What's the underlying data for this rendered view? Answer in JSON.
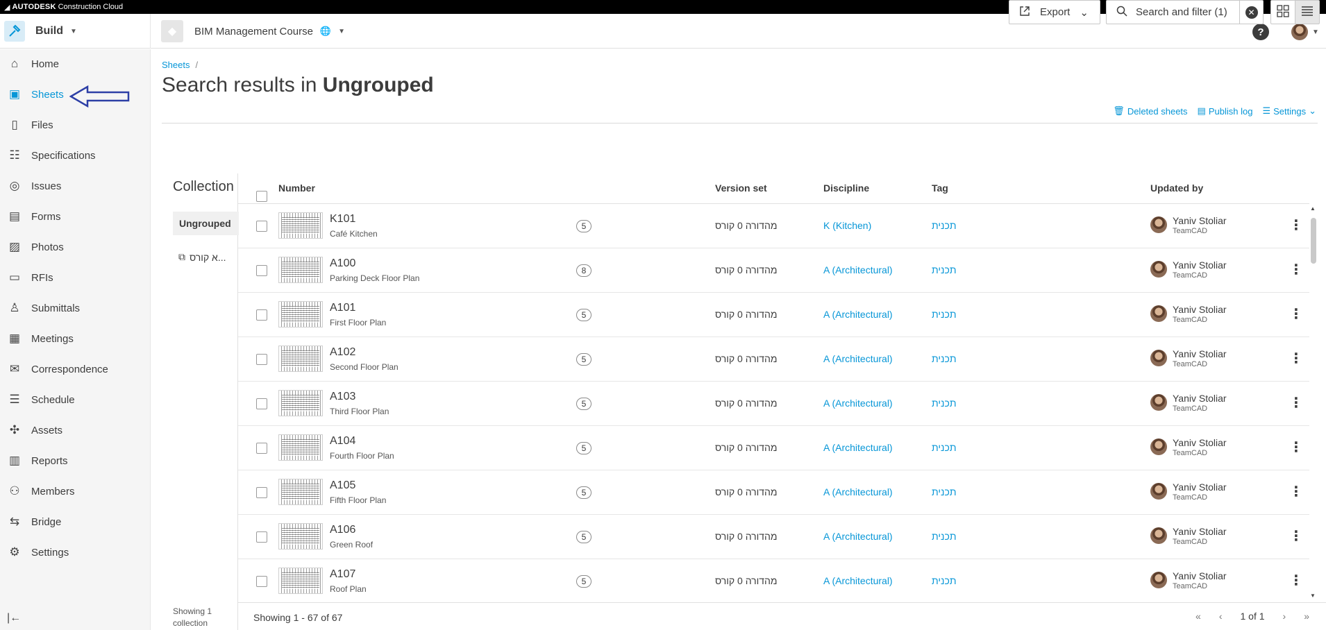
{
  "topbar": {
    "brand": "AUTODESK",
    "product": "Construction Cloud"
  },
  "header": {
    "app_name": "Build",
    "project_name": "BIM Management Course",
    "help_label": "?"
  },
  "sidebar": {
    "items": [
      {
        "label": "Home",
        "icon": "home-icon"
      },
      {
        "label": "Sheets",
        "icon": "sheets-icon"
      },
      {
        "label": "Files",
        "icon": "files-icon"
      },
      {
        "label": "Specifications",
        "icon": "specifications-icon"
      },
      {
        "label": "Issues",
        "icon": "issues-icon"
      },
      {
        "label": "Forms",
        "icon": "forms-icon"
      },
      {
        "label": "Photos",
        "icon": "photos-icon"
      },
      {
        "label": "RFIs",
        "icon": "rfis-icon"
      },
      {
        "label": "Submittals",
        "icon": "submittals-icon"
      },
      {
        "label": "Meetings",
        "icon": "meetings-icon"
      },
      {
        "label": "Correspondence",
        "icon": "correspondence-icon"
      },
      {
        "label": "Schedule",
        "icon": "schedule-icon"
      },
      {
        "label": "Assets",
        "icon": "assets-icon"
      },
      {
        "label": "Reports",
        "icon": "reports-icon"
      },
      {
        "label": "Members",
        "icon": "members-icon"
      },
      {
        "label": "Bridge",
        "icon": "bridge-icon"
      },
      {
        "label": "Settings",
        "icon": "settings-icon"
      }
    ],
    "active": "Sheets"
  },
  "breadcrumb": {
    "root": "Sheets",
    "separator": "/"
  },
  "page": {
    "title_prefix": "Search results in",
    "title_bold": "Ungrouped"
  },
  "links": {
    "deleted": "Deleted sheets",
    "publish": "Publish log",
    "settings": "Settings"
  },
  "toolbar": {
    "export": "Export",
    "search": "Search and filter (1)"
  },
  "collections": {
    "title": "Collection",
    "selected": "Ungrouped",
    "other": "א קורס...",
    "footer_line1": "Showing 1",
    "footer_line2": "collection"
  },
  "table": {
    "columns": {
      "number": "Number",
      "version_set": "Version set",
      "discipline": "Discipline",
      "tag": "Tag",
      "updated_by": "Updated by"
    },
    "rows": [
      {
        "number": "K101",
        "title": "Café Kitchen",
        "versions": "5",
        "version_set": "מהדורה 0 קורס",
        "discipline": "K (Kitchen)",
        "tag": "תכנית",
        "user": "Yaniv Stoliar",
        "company": "TeamCAD"
      },
      {
        "number": "A100",
        "title": "Parking Deck Floor Plan",
        "versions": "8",
        "version_set": "מהדורה 0 קורס",
        "discipline": "A (Architectural)",
        "tag": "תכנית",
        "user": "Yaniv Stoliar",
        "company": "TeamCAD"
      },
      {
        "number": "A101",
        "title": "First Floor Plan",
        "versions": "5",
        "version_set": "מהדורה 0 קורס",
        "discipline": "A (Architectural)",
        "tag": "תכנית",
        "user": "Yaniv Stoliar",
        "company": "TeamCAD"
      },
      {
        "number": "A102",
        "title": "Second Floor Plan",
        "versions": "5",
        "version_set": "מהדורה 0 קורס",
        "discipline": "A (Architectural)",
        "tag": "תכנית",
        "user": "Yaniv Stoliar",
        "company": "TeamCAD"
      },
      {
        "number": "A103",
        "title": "Third Floor Plan",
        "versions": "5",
        "version_set": "מהדורה 0 קורס",
        "discipline": "A (Architectural)",
        "tag": "תכנית",
        "user": "Yaniv Stoliar",
        "company": "TeamCAD"
      },
      {
        "number": "A104",
        "title": "Fourth Floor Plan",
        "versions": "5",
        "version_set": "מהדורה 0 קורס",
        "discipline": "A (Architectural)",
        "tag": "תכנית",
        "user": "Yaniv Stoliar",
        "company": "TeamCAD"
      },
      {
        "number": "A105",
        "title": "Fifth Floor Plan",
        "versions": "5",
        "version_set": "מהדורה 0 קורס",
        "discipline": "A (Architectural)",
        "tag": "תכנית",
        "user": "Yaniv Stoliar",
        "company": "TeamCAD"
      },
      {
        "number": "A106",
        "title": "Green Roof",
        "versions": "5",
        "version_set": "מהדורה 0 קורס",
        "discipline": "A (Architectural)",
        "tag": "תכנית",
        "user": "Yaniv Stoliar",
        "company": "TeamCAD"
      },
      {
        "number": "A107",
        "title": "Roof Plan",
        "versions": "5",
        "version_set": "מהדורה 0 קורס",
        "discipline": "A (Architectural)",
        "tag": "תכנית",
        "user": "Yaniv Stoliar",
        "company": "TeamCAD"
      }
    ]
  },
  "footer": {
    "showing": "Showing 1 - 67 of 67",
    "page": "1 of 1"
  },
  "colors": {
    "accent": "#0696d7",
    "annotation_arrow": "#2d3fa6"
  }
}
